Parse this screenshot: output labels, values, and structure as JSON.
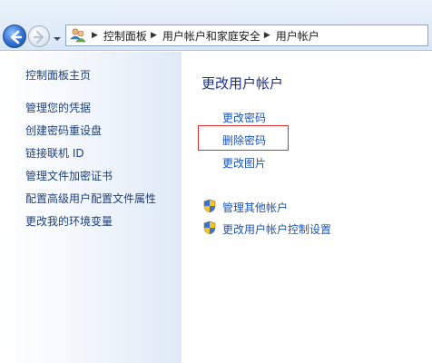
{
  "address_bar": {
    "breadcrumbs": [
      "控制面板",
      "用户帐户和家庭安全",
      "用户帐户"
    ],
    "icons": {
      "back": "back-arrow-icon",
      "forward": "forward-arrow-icon",
      "history": "chevron-down-icon",
      "location": "users-folder-icon"
    }
  },
  "sidebar": {
    "items": [
      {
        "label": "控制面板主页"
      },
      {
        "label": "管理您的凭据"
      },
      {
        "label": "创建密码重设盘"
      },
      {
        "label": "链接联机 ID"
      },
      {
        "label": "管理文件加密证书"
      },
      {
        "label": "配置高级用户配置文件属性"
      },
      {
        "label": "更改我的环境变量"
      }
    ]
  },
  "main": {
    "title": "更改用户帐户",
    "tasks": [
      {
        "label": "更改密码"
      },
      {
        "label": "删除密码",
        "highlighted": true
      },
      {
        "label": "更改图片"
      }
    ],
    "admin_tasks": [
      {
        "label": "管理其他帐户",
        "icon": "uac-shield-icon"
      },
      {
        "label": "更改用户帐户控制设置",
        "icon": "uac-shield-icon"
      }
    ]
  },
  "colors": {
    "link": "#1a54b5",
    "title": "#1e3287",
    "highlight_border": "#d9322d",
    "sidebar_link": "#1d3f7a"
  }
}
